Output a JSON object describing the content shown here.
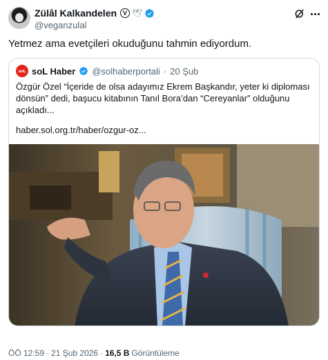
{
  "author": {
    "display_name": "Zülâl Kalkandelen",
    "badge_letter": "V",
    "handle": "@veganzulal"
  },
  "icons": {
    "verified": "verified-badge-icon",
    "grok": "grok-icon",
    "more": "more-options-icon"
  },
  "colors": {
    "verified_blue": "#1d9bf0",
    "text_primary": "#0f1419",
    "text_secondary": "#536471",
    "border": "#cfd9de",
    "brand_red": "#e2231a"
  },
  "tweet": {
    "text": "Yetmez ama evetçileri okuduğunu tahmin ediyordum."
  },
  "quote": {
    "logo_text": "soL",
    "name": "soL Haber",
    "handle": "@solhaberportali",
    "separator": "·",
    "date": "20 Şub",
    "body_lines": [
      "Özgür Özel “İçeride de olsa adayımız Ekrem Başkandır, yeter ki diploması",
      "dönsün” dedi, başucu kitabının Tanıl Bora’dan “Cereyanlar” olduğunu",
      "açıkladı..."
    ],
    "link": "haber.sol.org.tr/haber/ozgur-oz..."
  },
  "meta": {
    "time": "ÖÖ 12:59",
    "separator": "·",
    "date": "21 Şub 2026",
    "separator2": "·",
    "views_count": "16,5 B",
    "views_label": "Görüntüleme"
  }
}
